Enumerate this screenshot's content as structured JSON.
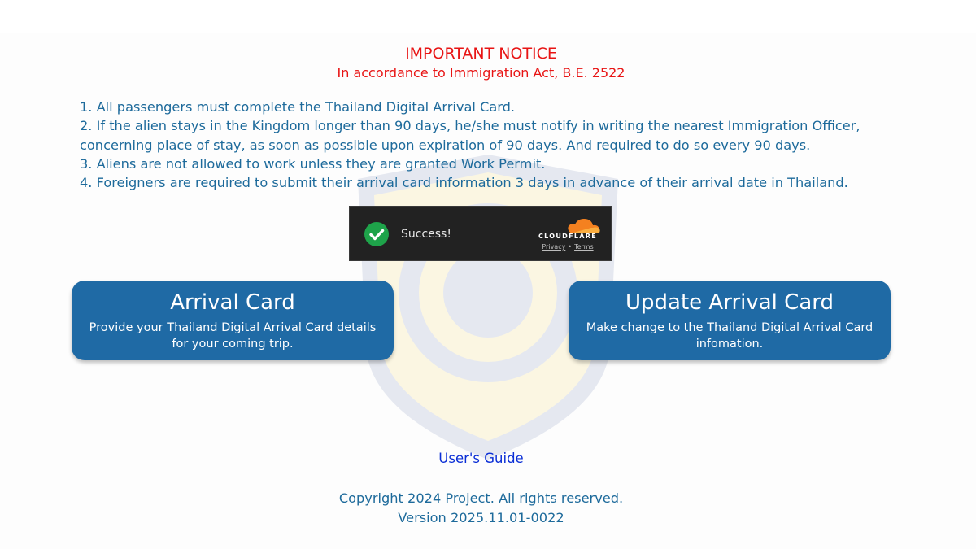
{
  "notice": {
    "title": "IMPORTANT NOTICE",
    "subtitle": "In accordance to Immigration Act, B.E. 2522"
  },
  "rules": [
    "1. All passengers must complete the Thailand Digital Arrival Card.",
    "2. If the alien stays in the Kingdom longer than 90 days, he/she must notify in writing the nearest Immigration Officer,",
    "concerning place of stay, as soon as possible upon expiration of 90 days. And required to do so every 90 days.",
    "3. Aliens are not allowed to work unless they are granted Work Permit.",
    "4. Foreigners are required to submit their arrival card information 3 days in advance of their arrival date in Thailand."
  ],
  "captcha": {
    "status": "Success!",
    "brand": "CLOUDFLARE",
    "privacy_label": "Privacy",
    "separator": "•",
    "terms_label": "Terms",
    "check_color": "#1ea34a",
    "brand_color": "#f48120"
  },
  "actions": {
    "arrival": {
      "title": "Arrival Card",
      "description": "Provide your Thailand Digital Arrival Card details for your coming trip."
    },
    "update": {
      "title": "Update Arrival Card",
      "description": "Make change to the Thailand Digital Arrival Card infomation."
    }
  },
  "guide": {
    "label": "User's Guide"
  },
  "footer": {
    "copyright": "Copyright 2024 Project. All rights reserved.",
    "version": "Version 2025.11.01-0022"
  },
  "colors": {
    "notice_red": "#e81414",
    "text_blue": "#1d6a9b",
    "button_blue": "#1f6aa5",
    "link_blue": "#0b2fd6"
  },
  "icons": {
    "watermark": "immigration-bureau-emblem",
    "captcha_check": "check-circle-icon",
    "captcha_logo": "cloudflare-cloud-icon"
  }
}
